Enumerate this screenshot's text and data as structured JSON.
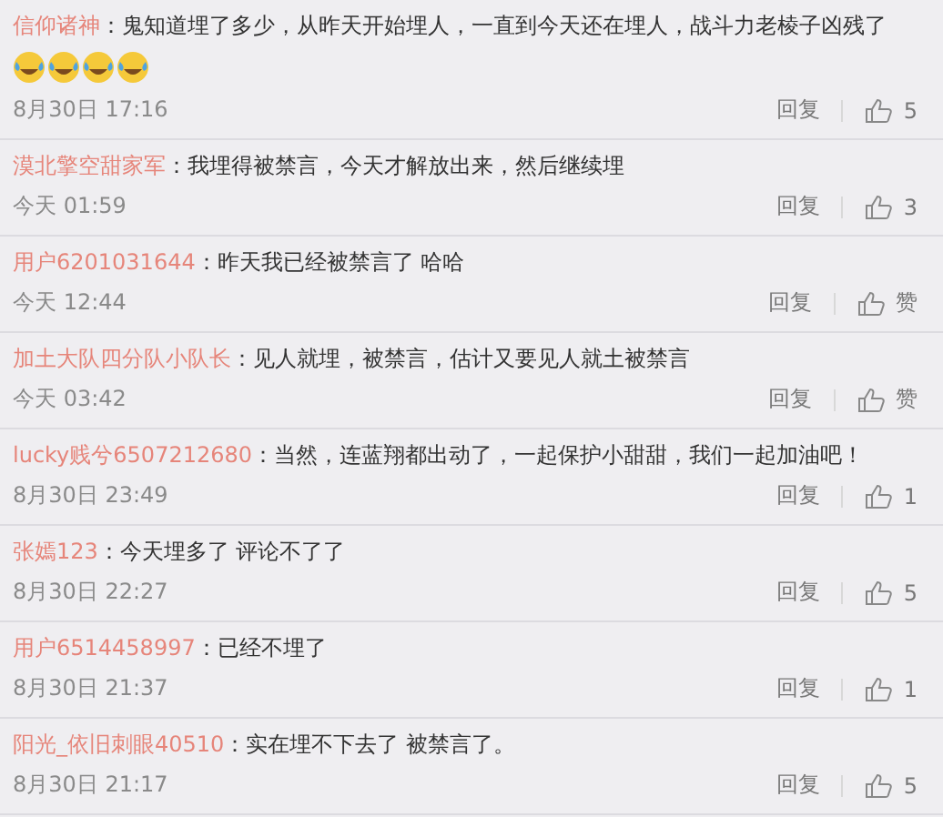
{
  "comments": [
    {
      "user": "信仰诸神",
      "sep": "：",
      "text": "鬼知道埋了多少，从昨天开始埋人，一直到今天还在埋人，战斗力老棱子凶残了",
      "emojis": [
        {
          "kind": "laugh-cry"
        },
        {
          "kind": "laugh-cry"
        },
        {
          "kind": "laugh-cry"
        },
        {
          "kind": "laugh-cry"
        }
      ],
      "time": "8月30日 17:16",
      "reply": "回复",
      "likes": "5"
    },
    {
      "user": "漠北擎空甜家军",
      "sep": "：",
      "text": "我埋得被禁言，今天才解放出来，然后继续埋",
      "time": "今天 01:59",
      "reply": "回复",
      "likes": "3"
    },
    {
      "user": "用户6201031644",
      "sep": "：",
      "text": "昨天我已经被禁言了  哈哈",
      "time": "今天 12:44",
      "reply": "回复",
      "likes": "赞"
    },
    {
      "user": "加土大队四分队小队长",
      "sep": "：",
      "text": "见人就埋，被禁言，估计又要见人就土被禁言",
      "time": "今天 03:42",
      "reply": "回复",
      "likes": "赞"
    },
    {
      "user": "lucky贱兮6507212680",
      "sep": "：",
      "text": "当然，连蓝翔都出动了，一起保护小甜甜，我们一起加油吧！",
      "time": "8月30日 23:49",
      "reply": "回复",
      "likes": "1"
    },
    {
      "user": "张嫣123",
      "sep": "：",
      "text": "今天埋多了  评论不了了",
      "time": "8月30日 22:27",
      "reply": "回复",
      "likes": "5"
    },
    {
      "user": "用户6514458997",
      "sep": "：",
      "text": "已经不埋了",
      "time": "8月30日 21:37",
      "reply": "回复",
      "likes": "1"
    },
    {
      "user": "阳光_依旧刺眼40510",
      "sep": "：",
      "text": "实在埋不下去了 被禁言了。",
      "time": "8月30日 21:17",
      "reply": "回复",
      "likes": "5"
    }
  ]
}
